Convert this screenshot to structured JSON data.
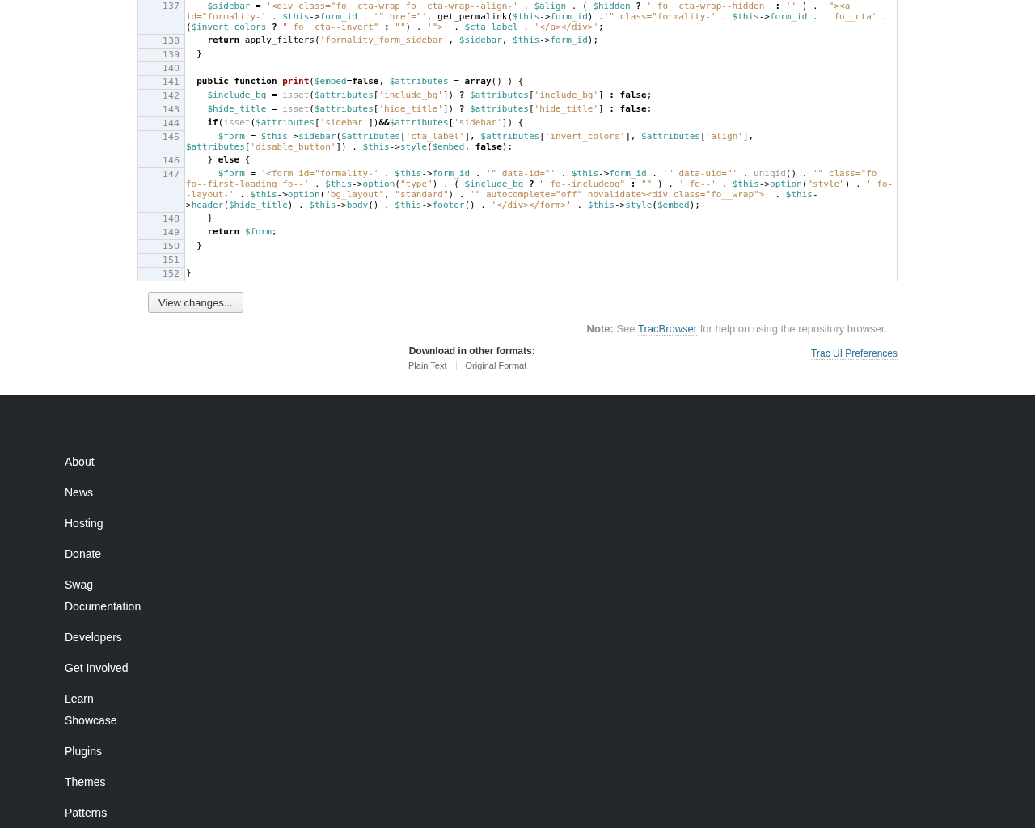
{
  "source": {
    "lines": [
      {
        "number": "137",
        "tokens": [
          {
            "kind": "var",
            "text": "    $sidebar"
          },
          {
            "kind": "plain",
            "text": " = "
          },
          {
            "kind": "str",
            "text": "'<div class=\"fo__cta-wrap fo__cta-wrap--align-'"
          },
          {
            "kind": "plain",
            "text": " . "
          },
          {
            "kind": "var",
            "text": "$align"
          },
          {
            "kind": "plain",
            "text": " . ( "
          },
          {
            "kind": "var",
            "text": "$hidden"
          },
          {
            "kind": "op",
            "text": " ? "
          },
          {
            "kind": "str",
            "text": "' fo__cta-wrap--hidden'"
          },
          {
            "kind": "op",
            "text": " : "
          },
          {
            "kind": "str",
            "text": "''"
          },
          {
            "kind": "plain",
            "text": " ) . "
          },
          {
            "kind": "str",
            "text": "'\"><a id=\"formality-'"
          },
          {
            "kind": "plain",
            "text": " . "
          },
          {
            "kind": "var",
            "text": "$this"
          },
          {
            "kind": "plain",
            "text": "->"
          },
          {
            "kind": "var",
            "text": "form_id"
          },
          {
            "kind": "plain",
            "text": " . "
          },
          {
            "kind": "str",
            "text": "'\" href=\"'"
          },
          {
            "kind": "plain",
            "text": ". get_permalink("
          },
          {
            "kind": "var",
            "text": "$this"
          },
          {
            "kind": "plain",
            "text": "->"
          },
          {
            "kind": "var",
            "text": "form_id"
          },
          {
            "kind": "plain",
            "text": ") ."
          },
          {
            "kind": "str",
            "text": "'\" class=\"formality-'"
          },
          {
            "kind": "plain",
            "text": " . "
          },
          {
            "kind": "var",
            "text": "$this"
          },
          {
            "kind": "plain",
            "text": "->"
          },
          {
            "kind": "var",
            "text": "form_id"
          },
          {
            "kind": "plain",
            "text": " . "
          },
          {
            "kind": "str",
            "text": "' fo__cta'"
          },
          {
            "kind": "plain",
            "text": " . ("
          },
          {
            "kind": "var",
            "text": "$invert_colors"
          },
          {
            "kind": "op",
            "text": " ? "
          },
          {
            "kind": "str",
            "text": "\" fo__cta--invert\""
          },
          {
            "kind": "op",
            "text": " : "
          },
          {
            "kind": "str",
            "text": "\"\""
          },
          {
            "kind": "plain",
            "text": ") . "
          },
          {
            "kind": "str",
            "text": "'\">'"
          },
          {
            "kind": "plain",
            "text": " . "
          },
          {
            "kind": "var",
            "text": "$cta_label"
          },
          {
            "kind": "plain",
            "text": " . "
          },
          {
            "kind": "str",
            "text": "'</a></div>'"
          },
          {
            "kind": "plain",
            "text": ";"
          }
        ]
      },
      {
        "number": "138",
        "tokens": [
          {
            "kind": "kw",
            "text": "    return"
          },
          {
            "kind": "plain",
            "text": " apply_filters("
          },
          {
            "kind": "str",
            "text": "'formality_form_sidebar'"
          },
          {
            "kind": "plain",
            "text": ", "
          },
          {
            "kind": "var",
            "text": "$sidebar"
          },
          {
            "kind": "plain",
            "text": ", "
          },
          {
            "kind": "var",
            "text": "$this"
          },
          {
            "kind": "plain",
            "text": "->"
          },
          {
            "kind": "var",
            "text": "form_id"
          },
          {
            "kind": "plain",
            "text": ");"
          }
        ]
      },
      {
        "number": "139",
        "tokens": [
          {
            "kind": "plain",
            "text": "  }"
          }
        ]
      },
      {
        "number": "140"
      },
      {
        "number": "141",
        "tokens": [
          {
            "kind": "kw",
            "text": "  public function "
          },
          {
            "kind": "fn",
            "text": "print"
          },
          {
            "kind": "plain",
            "text": "("
          },
          {
            "kind": "var",
            "text": "$embed"
          },
          {
            "kind": "plain",
            "text": "="
          },
          {
            "kind": "kw",
            "text": "false"
          },
          {
            "kind": "plain",
            "text": ", "
          },
          {
            "kind": "var",
            "text": "$attributes"
          },
          {
            "kind": "plain",
            "text": " = "
          },
          {
            "kind": "kw",
            "text": "array"
          },
          {
            "kind": "plain",
            "text": "() ) {"
          }
        ]
      },
      {
        "number": "142",
        "tokens": [
          {
            "kind": "var",
            "text": "    $include_bg"
          },
          {
            "kind": "plain",
            "text": " = "
          },
          {
            "kind": "builtin",
            "text": "isset"
          },
          {
            "kind": "plain",
            "text": "("
          },
          {
            "kind": "var",
            "text": "$attributes"
          },
          {
            "kind": "plain",
            "text": "["
          },
          {
            "kind": "str",
            "text": "'include_bg'"
          },
          {
            "kind": "plain",
            "text": "])"
          },
          {
            "kind": "op",
            "text": " ? "
          },
          {
            "kind": "var",
            "text": "$attributes"
          },
          {
            "kind": "plain",
            "text": "["
          },
          {
            "kind": "str",
            "text": "'include_bg'"
          },
          {
            "kind": "plain",
            "text": "]"
          },
          {
            "kind": "op",
            "text": " : "
          },
          {
            "kind": "kw",
            "text": "false"
          },
          {
            "kind": "plain",
            "text": ";"
          }
        ]
      },
      {
        "number": "143",
        "tokens": [
          {
            "kind": "var",
            "text": "    $hide_title"
          },
          {
            "kind": "plain",
            "text": " = "
          },
          {
            "kind": "builtin",
            "text": "isset"
          },
          {
            "kind": "plain",
            "text": "("
          },
          {
            "kind": "var",
            "text": "$attributes"
          },
          {
            "kind": "plain",
            "text": "["
          },
          {
            "kind": "str",
            "text": "'hide_title'"
          },
          {
            "kind": "plain",
            "text": "])"
          },
          {
            "kind": "op",
            "text": " ? "
          },
          {
            "kind": "var",
            "text": "$attributes"
          },
          {
            "kind": "plain",
            "text": "["
          },
          {
            "kind": "str",
            "text": "'hide_title'"
          },
          {
            "kind": "plain",
            "text": "]"
          },
          {
            "kind": "op",
            "text": " : "
          },
          {
            "kind": "kw",
            "text": "false"
          },
          {
            "kind": "plain",
            "text": ";"
          }
        ]
      },
      {
        "number": "144",
        "tokens": [
          {
            "kind": "kw",
            "text": "    if"
          },
          {
            "kind": "plain",
            "text": "("
          },
          {
            "kind": "builtin",
            "text": "isset"
          },
          {
            "kind": "plain",
            "text": "("
          },
          {
            "kind": "var",
            "text": "$attributes"
          },
          {
            "kind": "plain",
            "text": "["
          },
          {
            "kind": "str",
            "text": "'sidebar'"
          },
          {
            "kind": "plain",
            "text": "])"
          },
          {
            "kind": "op",
            "text": "&&"
          },
          {
            "kind": "var",
            "text": "$attributes"
          },
          {
            "kind": "plain",
            "text": "["
          },
          {
            "kind": "str",
            "text": "'sidebar'"
          },
          {
            "kind": "plain",
            "text": "]) {"
          }
        ]
      },
      {
        "number": "145",
        "tokens": [
          {
            "kind": "var",
            "text": "      $form"
          },
          {
            "kind": "plain",
            "text": " = "
          },
          {
            "kind": "var",
            "text": "$this"
          },
          {
            "kind": "plain",
            "text": "->"
          },
          {
            "kind": "var",
            "text": "sidebar"
          },
          {
            "kind": "plain",
            "text": "("
          },
          {
            "kind": "var",
            "text": "$attributes"
          },
          {
            "kind": "plain",
            "text": "["
          },
          {
            "kind": "str",
            "text": "'cta_label'"
          },
          {
            "kind": "plain",
            "text": "], "
          },
          {
            "kind": "var",
            "text": "$attributes"
          },
          {
            "kind": "plain",
            "text": "["
          },
          {
            "kind": "str",
            "text": "'invert_colors'"
          },
          {
            "kind": "plain",
            "text": "], "
          },
          {
            "kind": "var",
            "text": "$attributes"
          },
          {
            "kind": "plain",
            "text": "["
          },
          {
            "kind": "str",
            "text": "'align'"
          },
          {
            "kind": "plain",
            "text": "], "
          },
          {
            "kind": "var",
            "text": "$attributes"
          },
          {
            "kind": "plain",
            "text": "["
          },
          {
            "kind": "str",
            "text": "'disable_button'"
          },
          {
            "kind": "plain",
            "text": "]) . "
          },
          {
            "kind": "var",
            "text": "$this"
          },
          {
            "kind": "plain",
            "text": "->"
          },
          {
            "kind": "var",
            "text": "style"
          },
          {
            "kind": "plain",
            "text": "("
          },
          {
            "kind": "var",
            "text": "$embed"
          },
          {
            "kind": "plain",
            "text": ", "
          },
          {
            "kind": "kw",
            "text": "false"
          },
          {
            "kind": "plain",
            "text": ");"
          }
        ]
      },
      {
        "number": "146",
        "tokens": [
          {
            "kind": "plain",
            "text": "    } "
          },
          {
            "kind": "kw",
            "text": "else"
          },
          {
            "kind": "plain",
            "text": " {"
          }
        ]
      },
      {
        "number": "147",
        "tokens": [
          {
            "kind": "var",
            "text": "      $form"
          },
          {
            "kind": "plain",
            "text": " = "
          },
          {
            "kind": "str",
            "text": "'<form id=\"formality-'"
          },
          {
            "kind": "plain",
            "text": " . "
          },
          {
            "kind": "var",
            "text": "$this"
          },
          {
            "kind": "plain",
            "text": "->"
          },
          {
            "kind": "var",
            "text": "form_id"
          },
          {
            "kind": "plain",
            "text": " . "
          },
          {
            "kind": "str",
            "text": "'\" data-id=\"'"
          },
          {
            "kind": "plain",
            "text": " . "
          },
          {
            "kind": "var",
            "text": "$this"
          },
          {
            "kind": "plain",
            "text": "->"
          },
          {
            "kind": "var",
            "text": "form_id"
          },
          {
            "kind": "plain",
            "text": " . "
          },
          {
            "kind": "str",
            "text": "'\" data-uid=\"'"
          },
          {
            "kind": "plain",
            "text": " . "
          },
          {
            "kind": "builtin",
            "text": "uniqid"
          },
          {
            "kind": "plain",
            "text": "() . "
          },
          {
            "kind": "str",
            "text": "'\" class=\"fo fo--first-loading fo--'"
          },
          {
            "kind": "plain",
            "text": " . "
          },
          {
            "kind": "var",
            "text": "$this"
          },
          {
            "kind": "plain",
            "text": "->"
          },
          {
            "kind": "var",
            "text": "option"
          },
          {
            "kind": "plain",
            "text": "("
          },
          {
            "kind": "str",
            "text": "\"type\""
          },
          {
            "kind": "plain",
            "text": ") . ( "
          },
          {
            "kind": "var",
            "text": "$include_bg"
          },
          {
            "kind": "op",
            "text": " ? "
          },
          {
            "kind": "str",
            "text": "\" fo--includebg\""
          },
          {
            "kind": "op",
            "text": " : "
          },
          {
            "kind": "str",
            "text": "\"\""
          },
          {
            "kind": "plain",
            "text": " ) . "
          },
          {
            "kind": "str",
            "text": "' fo--'"
          },
          {
            "kind": "plain",
            "text": " . "
          },
          {
            "kind": "var",
            "text": "$this"
          },
          {
            "kind": "plain",
            "text": "->"
          },
          {
            "kind": "var",
            "text": "option"
          },
          {
            "kind": "plain",
            "text": "("
          },
          {
            "kind": "str",
            "text": "\"style\""
          },
          {
            "kind": "plain",
            "text": ") . "
          },
          {
            "kind": "str",
            "text": "' fo--layout-'"
          },
          {
            "kind": "plain",
            "text": " . "
          },
          {
            "kind": "var",
            "text": "$this"
          },
          {
            "kind": "plain",
            "text": "->"
          },
          {
            "kind": "var",
            "text": "option"
          },
          {
            "kind": "plain",
            "text": "("
          },
          {
            "kind": "str",
            "text": "\"bg_layout\""
          },
          {
            "kind": "plain",
            "text": ", "
          },
          {
            "kind": "str",
            "text": "\"standard\""
          },
          {
            "kind": "plain",
            "text": ") . "
          },
          {
            "kind": "str",
            "text": "'\" autocomplete=\"off\" novalidate><div class=\"fo__wrap\">'"
          },
          {
            "kind": "plain",
            "text": " . "
          },
          {
            "kind": "var",
            "text": "$this"
          },
          {
            "kind": "plain",
            "text": "->"
          },
          {
            "kind": "var",
            "text": "header"
          },
          {
            "kind": "plain",
            "text": "("
          },
          {
            "kind": "var",
            "text": "$hide_title"
          },
          {
            "kind": "plain",
            "text": ") . "
          },
          {
            "kind": "var",
            "text": "$this"
          },
          {
            "kind": "plain",
            "text": "->"
          },
          {
            "kind": "var",
            "text": "body"
          },
          {
            "kind": "plain",
            "text": "() . "
          },
          {
            "kind": "var",
            "text": "$this"
          },
          {
            "kind": "plain",
            "text": "->"
          },
          {
            "kind": "var",
            "text": "footer"
          },
          {
            "kind": "plain",
            "text": "() . "
          },
          {
            "kind": "str",
            "text": "'</div></form>'"
          },
          {
            "kind": "plain",
            "text": " . "
          },
          {
            "kind": "var",
            "text": "$this"
          },
          {
            "kind": "plain",
            "text": "->"
          },
          {
            "kind": "var",
            "text": "style"
          },
          {
            "kind": "plain",
            "text": "("
          },
          {
            "kind": "var",
            "text": "$embed"
          },
          {
            "kind": "plain",
            "text": ");"
          }
        ]
      },
      {
        "number": "148",
        "tokens": [
          {
            "kind": "plain",
            "text": "    }"
          }
        ]
      },
      {
        "number": "149",
        "tokens": [
          {
            "kind": "kw",
            "text": "    return "
          },
          {
            "kind": "var",
            "text": "$form"
          },
          {
            "kind": "plain",
            "text": ";"
          }
        ]
      },
      {
        "number": "150",
        "tokens": [
          {
            "kind": "plain",
            "text": "  }"
          }
        ]
      },
      {
        "number": "151"
      },
      {
        "number": "152",
        "tokens": [
          {
            "kind": "plain",
            "text": "}"
          }
        ]
      }
    ]
  },
  "view_changes_button": "View changes...",
  "note": {
    "before": "**Note:** See",
    "link": "TracBrowser",
    "after": "for help on using the repository browser."
  },
  "downloads": {
    "title": "Download in other formats:",
    "formats": [
      "Plain Text",
      "Original Format"
    ]
  },
  "preferences_link": "Trac UI Preferences",
  "footer": {
    "groups": [
      [
        "About",
        "News",
        "Hosting",
        "Donate",
        "Swag"
      ],
      [
        "Documentation",
        "Developers",
        "Get Involved",
        "Learn"
      ],
      [
        "Showcase",
        "Plugins",
        "Themes",
        "Patterns"
      ]
    ]
  }
}
